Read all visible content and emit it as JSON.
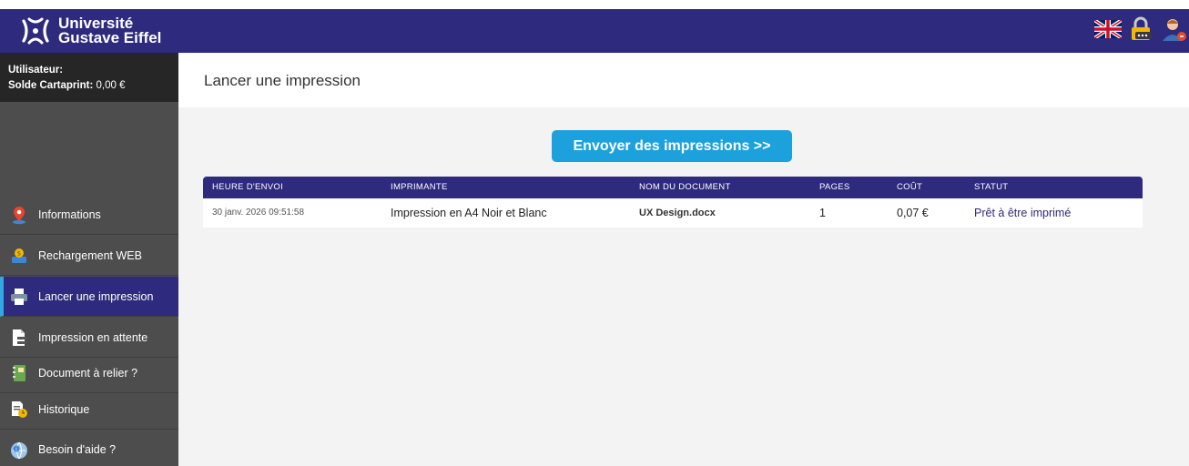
{
  "header": {
    "logo_line1": "Université",
    "logo_line2": "Gustave Eiffel",
    "icons": [
      "uk-flag-icon",
      "lock-password-icon",
      "user-logout-icon"
    ]
  },
  "sidebar": {
    "user_label": "Utilisateur:",
    "user_value": "",
    "balance_label": "Solde Cartaprint:",
    "balance_value": "0,00 €",
    "items": [
      {
        "label": "Informations",
        "icon": "location-pin-icon"
      },
      {
        "label": "Rechargement WEB",
        "icon": "coin-wallet-icon"
      },
      {
        "label": "Lancer une impression",
        "icon": "printer-icon",
        "active": true
      },
      {
        "label": "Impression en attente",
        "icon": "document-queue-icon"
      },
      {
        "label": "Document à relier ?",
        "icon": "binder-icon"
      },
      {
        "label": "Historique",
        "icon": "history-document-icon"
      },
      {
        "label": "Besoin d'aide ?",
        "icon": "help-globe-icon"
      }
    ]
  },
  "main": {
    "title": "Lancer une impression",
    "send_button": "Envoyer des impressions >>",
    "table": {
      "headers": [
        "HEURE D'ENVOI",
        "IMPRIMANTE",
        "NOM DU DOCUMENT",
        "PAGES",
        "COÛT",
        "STATUT"
      ],
      "rows": [
        [
          "30 janv. 2026 09:51:58",
          "Impression en A4 Noir et Blanc",
          "UX Design.docx",
          "1",
          "0,07 €",
          "Prêt à être imprimé"
        ]
      ]
    }
  },
  "colors": {
    "brand": "#2e2a7d",
    "accent": "#1da1dd",
    "sidebar": "#4d4d4d"
  }
}
